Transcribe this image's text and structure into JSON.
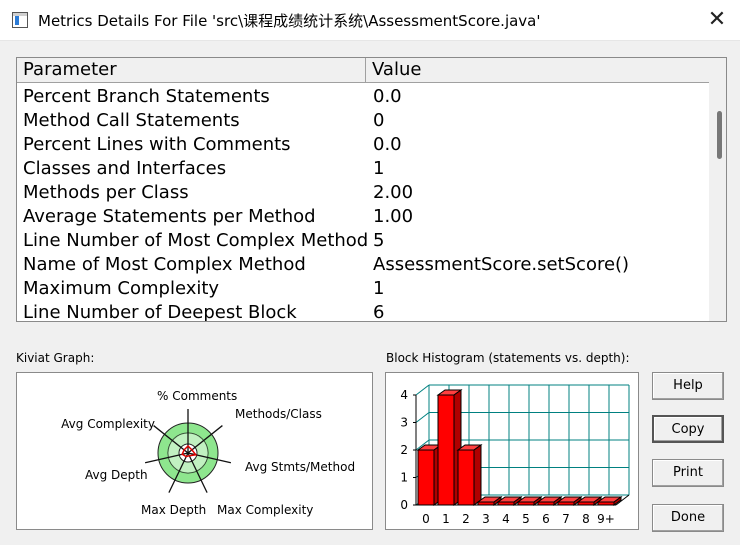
{
  "window": {
    "title": "Metrics Details For File 'src\\课程成绩统计系统\\AssessmentScore.java'",
    "close_glyph": "✕"
  },
  "table": {
    "columns": [
      "Parameter",
      "Value"
    ],
    "rows": [
      {
        "param": "Percent Branch Statements",
        "value": "0.0"
      },
      {
        "param": "Method Call Statements",
        "value": "0"
      },
      {
        "param": "Percent Lines with Comments",
        "value": "0.0"
      },
      {
        "param": "Classes and Interfaces",
        "value": "1"
      },
      {
        "param": "Methods per Class",
        "value": "2.00"
      },
      {
        "param": "Average Statements per Method",
        "value": "1.00"
      },
      {
        "param": "Line Number of Most Complex Method",
        "value": "5"
      },
      {
        "param": "Name of Most Complex Method",
        "value": "AssessmentScore.setScore()"
      },
      {
        "param": "Maximum Complexity",
        "value": "1"
      },
      {
        "param": "Line Number of Deepest Block",
        "value": "6"
      }
    ]
  },
  "kiviat": {
    "label": "Kiviat Graph:",
    "axes": [
      "% Comments",
      "Methods/Class",
      "Avg Stmts/Method",
      "Max Complexity",
      "Max Depth",
      "Avg Depth",
      "Avg Complexity"
    ],
    "fill_color": "#8ee68e"
  },
  "histogram": {
    "label": "Block Histogram (statements vs. depth):",
    "categories": [
      "0",
      "1",
      "2",
      "3",
      "4",
      "5",
      "6",
      "7",
      "8",
      "9+"
    ],
    "values": [
      2,
      4,
      2,
      0,
      0,
      0,
      0,
      0,
      0,
      0
    ],
    "y_ticks": [
      "0",
      "1",
      "2",
      "3",
      "4"
    ],
    "ylim": [
      0,
      4
    ],
    "bar_color": "#ff0000",
    "grid_color": "#008080"
  },
  "buttons": {
    "help": "Help",
    "copy": "Copy",
    "print": "Print",
    "done": "Done"
  }
}
